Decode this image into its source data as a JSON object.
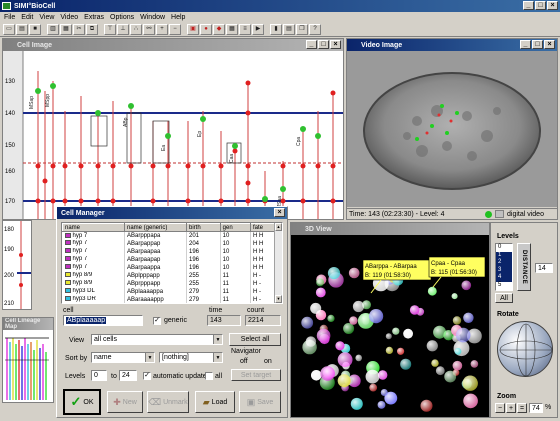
{
  "app": {
    "title": "SIMI°BioCell",
    "menu": [
      "File",
      "Edit",
      "View",
      "Video",
      "Extras",
      "Options",
      "Window",
      "Help"
    ]
  },
  "cell_image": {
    "title": "Cell Image",
    "y_ticks": [
      "130",
      "140",
      "150",
      "160",
      "170",
      "180",
      "190",
      "200",
      "210"
    ],
    "node_labels": [
      "MSap",
      "MSpp",
      "ABp",
      "Ea",
      "Ep",
      "Caa",
      "Cpa",
      "MSaa"
    ]
  },
  "video_image": {
    "title": "Video Image",
    "status_time": "Time: 143 (02:23:30) - Level: 4",
    "digital_video": "digital video"
  },
  "view3d": {
    "title": "3D View",
    "callouts": [
      {
        "name": "ABarppa - ABarpaa",
        "stat": "B: 119 (01:58:30)"
      },
      {
        "name": "Cpaa - Cpaa",
        "stat": "B: 115 (01:56:30)"
      }
    ],
    "levels_label": "Levels",
    "levels": [
      "0",
      "1",
      "2",
      "3",
      "4",
      "5"
    ],
    "distance_label": "DISTANCE",
    "distance_value": "14",
    "all_button": "All",
    "rotate_label": "Rotate",
    "zoom_label": "Zoom",
    "zoom_value": "74",
    "zoom_unit": "%"
  },
  "cell_manager": {
    "title": "Cell Manager",
    "columns": [
      "name",
      "name (generic)",
      "birth",
      "gen",
      "fate"
    ],
    "rows": [
      {
        "color": "#c030c0",
        "name": "hyp 7",
        "generic": "ABarpppapa",
        "birth": "201",
        "gen": "10",
        "fate": "H H"
      },
      {
        "color": "#c030c0",
        "name": "hyp 7",
        "generic": "ABarpappap",
        "birth": "204",
        "gen": "10",
        "fate": "H H"
      },
      {
        "color": "#c030c0",
        "name": "hyp 7",
        "generic": "ABarpaapaa",
        "birth": "196",
        "gen": "10",
        "fate": "H H"
      },
      {
        "color": "#c030c0",
        "name": "hyp 7",
        "generic": "ABarpaapap",
        "birth": "196",
        "gen": "10",
        "fate": "H H"
      },
      {
        "color": "#c030c0",
        "name": "hyp 7",
        "generic": "ABarpaappa",
        "birth": "196",
        "gen": "10",
        "fate": "H H"
      },
      {
        "color": "#e8e830",
        "name": "hyp 8/9",
        "generic": "ABplpppapp",
        "birth": "255",
        "gen": "11",
        "fate": "H -"
      },
      {
        "color": "#e8e830",
        "name": "hyp 8/9",
        "generic": "ABprpppapp",
        "birth": "255",
        "gen": "11",
        "fate": "H -"
      },
      {
        "color": "#30c0e0",
        "name": "hyp3 DL",
        "generic": "ABplaaaappa",
        "birth": "279",
        "gen": "11",
        "fate": "H -"
      },
      {
        "color": "#30c0e0",
        "name": "hyp3 DR",
        "generic": "ABaraaaappp",
        "birth": "279",
        "gen": "11",
        "fate": "H -"
      }
    ],
    "cell_label": "cell",
    "cell_value": "ABplaaaaap",
    "generic_label": "generic",
    "time_label": "time",
    "time_value": "143",
    "count_label": "count",
    "count_value": "2214",
    "view_label": "View",
    "view_value": "all cells",
    "select_all": "Select all",
    "sort_label": "Sort by",
    "sort_value": "name",
    "sort_secondary": "[nothing]",
    "navigator_label": "Navigator",
    "off_label": "off",
    "on_label": "on",
    "set_target": "Set target",
    "levels_label": "Levels",
    "levels_from": "0",
    "to_label": "to",
    "levels_to": "24",
    "auto_update": "automatic update",
    "all_label": "all",
    "buttons": {
      "ok": "OK",
      "new": "New",
      "unmark": "Unmark",
      "load": "Load",
      "save": "Save"
    }
  },
  "lineage_map": {
    "title": "Cell Lineage Map"
  }
}
